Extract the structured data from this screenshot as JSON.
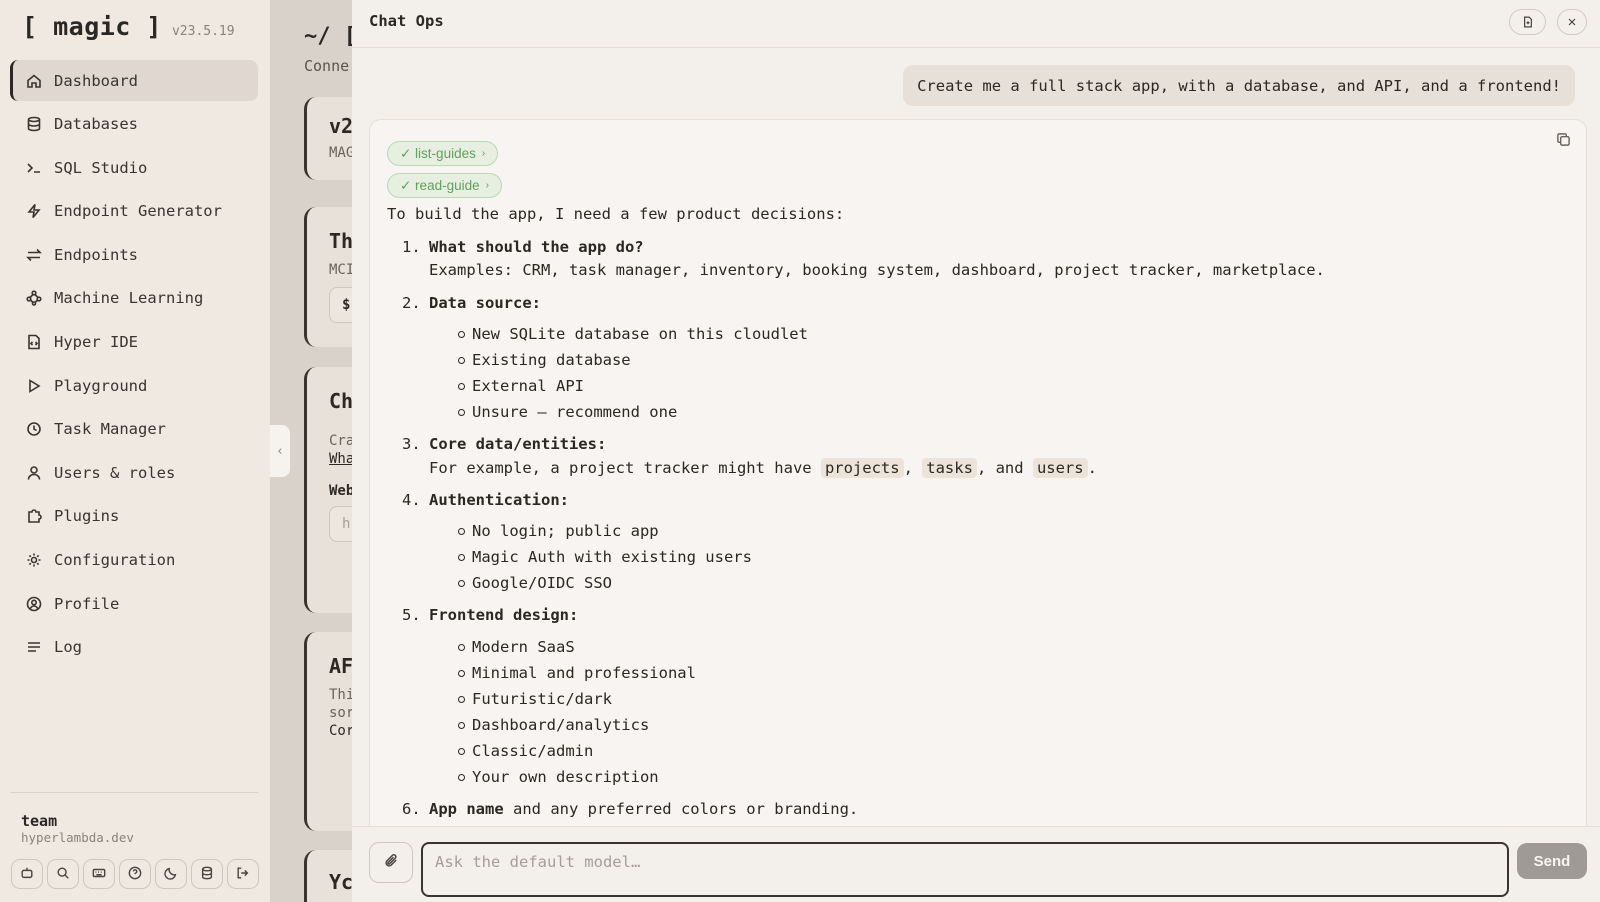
{
  "app": {
    "name": "[ magic ]",
    "version": "v23.5.19"
  },
  "sidebar": {
    "items": [
      {
        "label": "Dashboard",
        "icon": "home-icon",
        "active": true
      },
      {
        "label": "Databases",
        "icon": "database-icon"
      },
      {
        "label": "SQL Studio",
        "icon": "terminal-icon"
      },
      {
        "label": "Endpoint Generator",
        "icon": "bolt-icon"
      },
      {
        "label": "Endpoints",
        "icon": "arrows-icon"
      },
      {
        "label": "Machine Learning",
        "icon": "network-icon"
      },
      {
        "label": "Hyper IDE",
        "icon": "code-file-icon"
      },
      {
        "label": "Playground",
        "icon": "play-icon"
      },
      {
        "label": "Task Manager",
        "icon": "clock-icon"
      },
      {
        "label": "Users & roles",
        "icon": "user-icon"
      },
      {
        "label": "Plugins",
        "icon": "puzzle-icon"
      },
      {
        "label": "Configuration",
        "icon": "gear-icon"
      },
      {
        "label": "Profile",
        "icon": "profile-icon"
      },
      {
        "label": "Log",
        "icon": "list-icon"
      }
    ],
    "user": {
      "name": "team",
      "domain": "hyperlambda.dev"
    },
    "tools": [
      "robot-icon",
      "search-icon",
      "keyboard-icon",
      "help-icon",
      "moon-icon",
      "database-icon",
      "logout-icon"
    ]
  },
  "main": {
    "title": "~/ [",
    "subtitle": "Conne",
    "cards": [
      {
        "title": "v2",
        "line1": "MAG"
      },
      {
        "title": "Th",
        "line1": "MCI",
        "chip": "$"
      },
      {
        "title": "Ch",
        "line1": "Cra",
        "line2": "Wha",
        "line3": "Web",
        "chip": "h"
      },
      {
        "title": "AF",
        "line1": "Thi",
        "line2": "sor",
        "line3": "Cor"
      },
      {
        "title": "Yc"
      }
    ]
  },
  "chat": {
    "title": "Chat Ops",
    "user_message": "Create me a full stack app, with a database, and API, and a frontend!",
    "tools": [
      "✓ list-guides",
      "✓ read-guide"
    ],
    "intro": "To build the app, I need a few product decisions:",
    "q1": {
      "num": "1.",
      "title": "What should the app do?",
      "line": "Examples: CRM, task manager, inventory, booking system, dashboard, project tracker, marketplace."
    },
    "q2": {
      "num": "2.",
      "title": "Data source:",
      "bullets": [
        "New SQLite database on this cloudlet",
        "Existing database",
        "External API",
        "Unsure — recommend one"
      ]
    },
    "q3": {
      "num": "3.",
      "title": "Core data/entities:",
      "prefix": "For example, a project tracker might have ",
      "code1": "projects",
      "sep1": ", ",
      "code2": "tasks",
      "sep2": ", and ",
      "code3": "users",
      "suffix": "."
    },
    "q4": {
      "num": "4.",
      "title": "Authentication:",
      "bullets": [
        "No login; public app",
        "Magic Auth with existing users",
        "Google/OIDC SSO"
      ]
    },
    "q5": {
      "num": "5.",
      "title": "Frontend design:",
      "bullets": [
        "Modern SaaS",
        "Minimal and professional",
        "Futuristic/dark",
        "Dashboard/analytics",
        "Classic/admin",
        "Your own description"
      ]
    },
    "q6": {
      "num": "6.",
      "title": "App name",
      "rest": " and any preferred colors or branding."
    },
    "input_placeholder": "Ask the default model…",
    "send_label": "Send"
  }
}
